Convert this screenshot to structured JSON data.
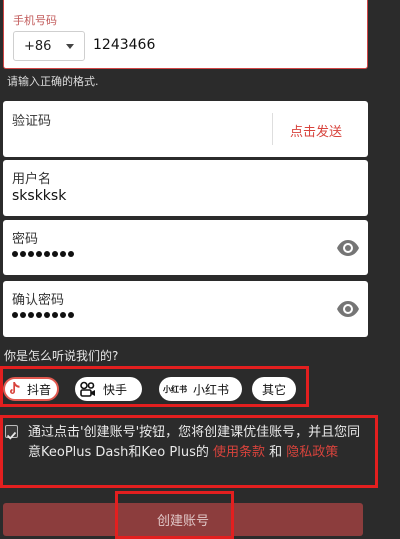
{
  "phone_field": {
    "label": "手机号码",
    "country_code": "+86",
    "value": "1243466",
    "error": "请输入正确的格式."
  },
  "code_field": {
    "label": "验证码",
    "send_button": "点击发送"
  },
  "username_field": {
    "label": "用户名",
    "value": "skskksk"
  },
  "password_field": {
    "label": "密码",
    "masked_length": 8,
    "toggle_icon": "eye-icon"
  },
  "confirm_password_field": {
    "label": "确认密码",
    "masked_length": 8,
    "toggle_icon": "eye-icon"
  },
  "source_question": "你是怎么听说我们的?",
  "sources": [
    {
      "label": "抖音",
      "icon": "douyin-icon",
      "selected": true
    },
    {
      "label": "快手",
      "icon": "kuaishou-icon",
      "selected": false
    },
    {
      "label": "小红书",
      "icon": "xiaohongshu-icon",
      "icon_text": "小红书",
      "selected": false
    },
    {
      "label": "其它",
      "icon": "",
      "selected": false
    }
  ],
  "terms": {
    "checked": true,
    "text": "通过点击'创建账号'按钮，您将创建课优佳账号，并且您同意KeoPlus Dash和Keo Plus的",
    "link_terms": "使用条款",
    "conjunction": "和",
    "link_privacy": "隐私政策"
  },
  "submit_label": "创建账号",
  "colors": {
    "accent": "#d8433c",
    "background": "#2b2b2b",
    "highlight_box": "#e31f1f",
    "submit_bg": "#8c3d3d"
  }
}
